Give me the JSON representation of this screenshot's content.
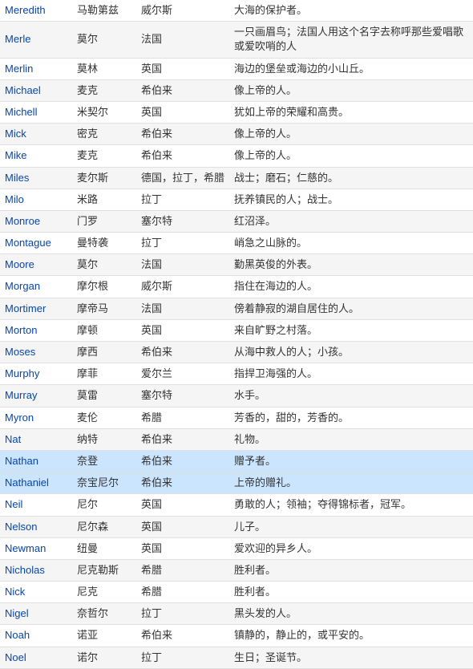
{
  "rows": [
    {
      "name": "Meredith",
      "chinese": "马勒第兹",
      "origin": "威尔斯",
      "meaning": "大海的保护者。",
      "highlight": false
    },
    {
      "name": "Merle",
      "chinese": "莫尔",
      "origin": "法国",
      "meaning": "一只画眉鸟；法国人用这个名字去称呼那些爱唱歌或爱吹哨的人",
      "highlight": false
    },
    {
      "name": "Merlin",
      "chinese": "莫林",
      "origin": "英国",
      "meaning": "海边的堡垒或海边的小山丘。",
      "highlight": false
    },
    {
      "name": "Michael",
      "chinese": "麦克",
      "origin": "希伯来",
      "meaning": "像上帝的人。",
      "highlight": false
    },
    {
      "name": "Michell",
      "chinese": "米契尔",
      "origin": "英国",
      "meaning": "犹如上帝的荣耀和高贵。",
      "highlight": false
    },
    {
      "name": "Mick",
      "chinese": "密克",
      "origin": "希伯来",
      "meaning": "像上帝的人。",
      "highlight": false
    },
    {
      "name": "Mike",
      "chinese": "麦克",
      "origin": "希伯来",
      "meaning": "像上帝的人。",
      "highlight": false
    },
    {
      "name": "Miles",
      "chinese": "麦尔斯",
      "origin": "德国，拉丁，希腊",
      "meaning": "战士；磨石；仁慈的。",
      "highlight": false
    },
    {
      "name": "Milo",
      "chinese": "米路",
      "origin": "拉丁",
      "meaning": "抚养镇民的人；战士。",
      "highlight": false
    },
    {
      "name": "Monroe",
      "chinese": "门罗",
      "origin": "塞尔特",
      "meaning": "红沼泽。",
      "highlight": false
    },
    {
      "name": "Montague",
      "chinese": "曼特袭",
      "origin": "拉丁",
      "meaning": "峭急之山脉的。",
      "highlight": false
    },
    {
      "name": "Moore",
      "chinese": "莫尔",
      "origin": "法国",
      "meaning": "勤黑英俊的外表。",
      "highlight": false
    },
    {
      "name": "Morgan",
      "chinese": "摩尔根",
      "origin": "威尔斯",
      "meaning": "指住在海边的人。",
      "highlight": false
    },
    {
      "name": "Mortimer",
      "chinese": "摩帝马",
      "origin": "法国",
      "meaning": "傍着静寂的湖自居住的人。",
      "highlight": false
    },
    {
      "name": "Morton",
      "chinese": "摩顿",
      "origin": "英国",
      "meaning": "来自旷野之村落。",
      "highlight": false
    },
    {
      "name": "Moses",
      "chinese": "摩西",
      "origin": "希伯来",
      "meaning": "从海中救人的人；小孩。",
      "highlight": false
    },
    {
      "name": "Murphy",
      "chinese": "摩菲",
      "origin": "爱尔兰",
      "meaning": "指捍卫海强的人。",
      "highlight": false
    },
    {
      "name": "Murray",
      "chinese": "莫雷",
      "origin": "塞尔特",
      "meaning": "水手。",
      "highlight": false
    },
    {
      "name": "Myron",
      "chinese": "麦伦",
      "origin": "希腊",
      "meaning": "芳香的，甜的，芳香的。",
      "highlight": false
    },
    {
      "name": "Nat",
      "chinese": "纳特",
      "origin": "希伯来",
      "meaning": "礼物。",
      "highlight": false
    },
    {
      "name": "Nathan",
      "chinese": "奈登",
      "origin": "希伯来",
      "meaning": "赠予者。",
      "highlight": true
    },
    {
      "name": "Nathaniel",
      "chinese": "奈宝尼尔",
      "origin": "希伯来",
      "meaning": "上帝的赠礼。",
      "highlight": true
    },
    {
      "name": "Neil",
      "chinese": "尼尔",
      "origin": "英国",
      "meaning": "勇敢的人；领袖；夺得锦标者，冠军。",
      "highlight": false
    },
    {
      "name": "Nelson",
      "chinese": "尼尔森",
      "origin": "英国",
      "meaning": "儿子。",
      "highlight": false
    },
    {
      "name": "Newman",
      "chinese": "纽曼",
      "origin": "英国",
      "meaning": "爱欢迎的异乡人。",
      "highlight": false
    },
    {
      "name": "Nicholas",
      "chinese": "尼克勒斯",
      "origin": "希腊",
      "meaning": "胜利者。",
      "highlight": false
    },
    {
      "name": "Nick",
      "chinese": "尼克",
      "origin": "希腊",
      "meaning": "胜利者。",
      "highlight": false
    },
    {
      "name": "Nigel",
      "chinese": "奈哲尔",
      "origin": "拉丁",
      "meaning": "黑头发的人。",
      "highlight": false
    },
    {
      "name": "Noah",
      "chinese": "诺亚",
      "origin": "希伯来",
      "meaning": "镇静的，静止的，或平安的。",
      "highlight": false
    },
    {
      "name": "Noel",
      "chinese": "诺尔",
      "origin": "拉丁",
      "meaning": "生日；圣诞节。",
      "highlight": false
    }
  ]
}
